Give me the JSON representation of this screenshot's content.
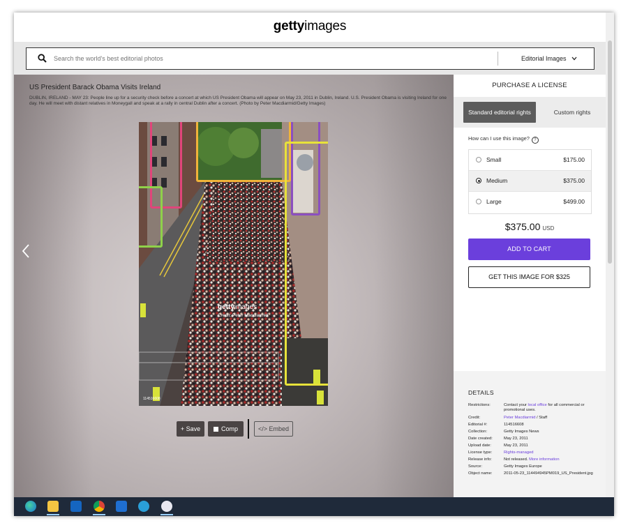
{
  "app": {
    "logo_bold": "getty",
    "logo_light": "images"
  },
  "search": {
    "placeholder": "Search the world's best editorial photos",
    "filter_label": "Editorial Images"
  },
  "image": {
    "title": "US President Barack Obama Visits Ireland",
    "caption": "DUBLIN, IRELAND - MAY 23: People line up for a security check before a concert at which US President Obama will appear on May 23, 2011 in Dublin, Ireland. U.S. President Obama is visiting Ireland for one day. He will meet with distant relatives in Moneygall and speak at a rally in central Dublin after a concert. (Photo by Peter Macdiarmid/Getty Images)",
    "watermark_bold": "getty",
    "watermark_light": "images",
    "watermark_credit": "Credit: Peter Macdiarmid",
    "id_label": "114516608",
    "bbox_colors": [
      "#e0457a",
      "#f0b43a",
      "#8b4fc0",
      "#e8e23a",
      "#8fd14a"
    ]
  },
  "actions": {
    "save": "+ Save",
    "comp": "Comp",
    "embed": "</> Embed"
  },
  "license": {
    "header": "PURCHASE A LICENSE",
    "tab_standard": "Standard editorial rights",
    "tab_custom": "Custom rights",
    "question": "How can I use this image?",
    "sizes": [
      {
        "label": "Small",
        "price": "$175.00",
        "selected": false
      },
      {
        "label": "Medium",
        "price": "$375.00",
        "selected": true
      },
      {
        "label": "Large",
        "price": "$499.00",
        "selected": false
      }
    ],
    "total": "$375.00",
    "currency": "USD",
    "add_to_cart": "ADD TO CART",
    "get_image": "GET THIS IMAGE FOR $325",
    "accent_color": "#6b3fdc"
  },
  "details": {
    "title": "DETAILS",
    "restrictions_key": "Restrictions:",
    "restrictions_pre": "Contact your ",
    "restrictions_link": "local office",
    "restrictions_post": " for all commercial or promotional uses.",
    "credit_key": "Credit:",
    "credit_link": "Peter Macdiarmid",
    "credit_post": " / Staff",
    "editorial_key": "Editorial #:",
    "editorial_val": "114516608",
    "collection_key": "Collection:",
    "collection_val": "Getty Images News",
    "created_key": "Date created:",
    "created_val": "May 23, 2011",
    "upload_key": "Upload date:",
    "upload_val": "May 23, 2011",
    "license_key": "License type:",
    "license_val": "Rights-managed",
    "release_key": "Release info:",
    "release_val": "Not released. ",
    "release_link": "More information",
    "source_key": "Source:",
    "source_val": "Getty Images Europe",
    "object_key": "Object name:",
    "object_val": "2011-05-23_114494945PM019_US_President.jpg"
  },
  "taskbar": {
    "icons": [
      "edge-icon",
      "file-explorer-icon",
      "outlook-icon",
      "chrome-icon",
      "teams-icon",
      "remote-desktop-icon",
      "notification-app-icon"
    ]
  }
}
